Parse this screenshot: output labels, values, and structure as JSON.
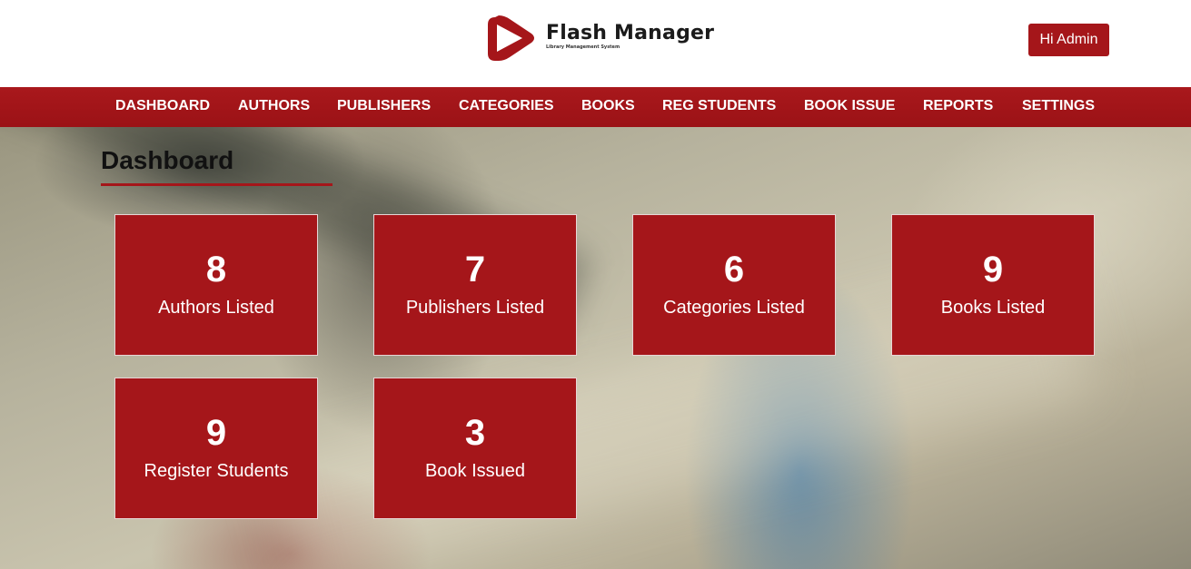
{
  "header": {
    "logo_title": "Flash Manager",
    "logo_subtitle": "Library Management System",
    "admin_button": "Hi Admin"
  },
  "nav": {
    "items": [
      {
        "label": "DASHBOARD"
      },
      {
        "label": "AUTHORS"
      },
      {
        "label": "PUBLISHERS"
      },
      {
        "label": "CATEGORIES"
      },
      {
        "label": "BOOKS"
      },
      {
        "label": "REG STUDENTS"
      },
      {
        "label": "BOOK ISSUE"
      },
      {
        "label": "REPORTS"
      },
      {
        "label": "SETTINGS"
      }
    ]
  },
  "main": {
    "title": "Dashboard",
    "cards": [
      {
        "value": "8",
        "label": "Authors Listed"
      },
      {
        "value": "7",
        "label": "Publishers Listed"
      },
      {
        "value": "6",
        "label": "Categories Listed"
      },
      {
        "value": "9",
        "label": "Books Listed"
      },
      {
        "value": "9",
        "label": "Register Students"
      },
      {
        "value": "3",
        "label": "Book Issued"
      }
    ]
  },
  "colors": {
    "brand": "#a5161a",
    "nav_bg": "#a9181c",
    "text_dark": "#111111"
  },
  "icons": {
    "logo": "play-icon"
  }
}
